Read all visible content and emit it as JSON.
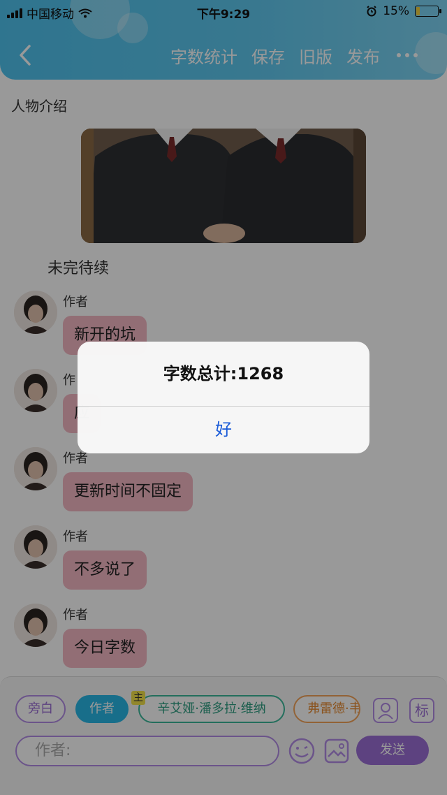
{
  "status_bar": {
    "carrier": "中国移动",
    "time": "下午9:29",
    "battery_percent": "15%",
    "battery_level": 0.15
  },
  "nav": {
    "actions": {
      "word_count": "字数统计",
      "save": "保存",
      "old_version": "旧版",
      "publish": "发布"
    }
  },
  "content": {
    "section_title": "人物介绍",
    "unfinished_text": "未完待续",
    "messages": [
      {
        "author": "作者",
        "text": "新开的坑"
      },
      {
        "author": "作",
        "text": "应"
      },
      {
        "author": "作者",
        "text": "更新时间不固定"
      },
      {
        "author": "作者",
        "text": "不多说了"
      },
      {
        "author": "作者",
        "text": "今日字数"
      }
    ]
  },
  "composer": {
    "roles": {
      "narration": "旁白",
      "author": "作者",
      "main_badge": "主",
      "character1": "辛艾娅·潘多拉·维纳",
      "character2": "弗雷德·韦"
    },
    "icons": [
      "person-icon",
      "tag-icon",
      "emoji-icon",
      "image-icon"
    ],
    "icon_tag_label": "标",
    "input_placeholder": "作者:",
    "send_label": "发送"
  },
  "alert": {
    "title": "字数总计:1268",
    "ok_label": "好"
  },
  "colors": {
    "header": "#5ec8ef",
    "bubble": "#f4b8c4",
    "accent_purple": "#9c6fd6",
    "author_chip": "#29b7e6",
    "alert_button": "#1a5bd8"
  }
}
